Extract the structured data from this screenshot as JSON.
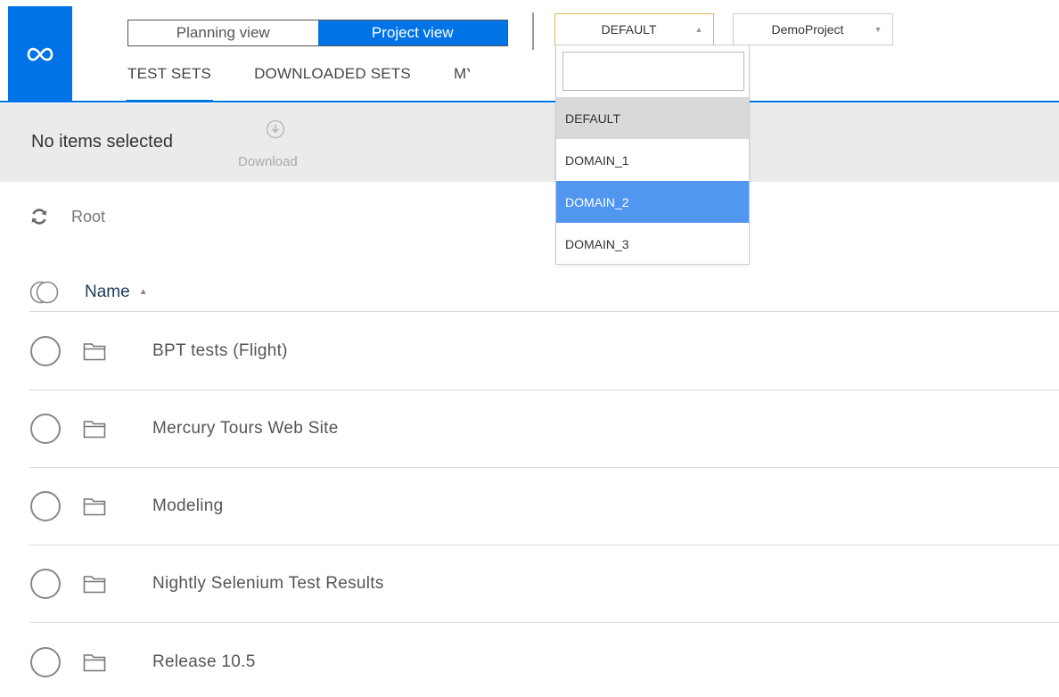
{
  "header": {
    "logo_icon": "infinity-logo-icon",
    "view_toggle": {
      "planning_label": "Planning view",
      "project_label": "Project view",
      "active": "Project view"
    },
    "domain_select": {
      "value": "DEFAULT",
      "arrow_icon": "triangle-up-icon"
    },
    "project_select": {
      "value": "DemoProject",
      "arrow_icon": "triangle-down-icon"
    },
    "tabs": [
      {
        "label": "TEST SETS",
        "active": true
      },
      {
        "label": "DOWNLOADED SETS",
        "active": false
      },
      {
        "label": "MY",
        "active": false
      }
    ],
    "accent_color": "#0073e7"
  },
  "toolbar": {
    "selection_text": "No items selected",
    "download_label": "Download",
    "download_icon": "download-circle-icon"
  },
  "breadcrumb": {
    "refresh_icon": "refresh-icon",
    "root_label": "Root"
  },
  "list": {
    "column_name": "Name",
    "sort_icon": "sort-icon",
    "rows": [
      {
        "label": "BPT tests (Flight)"
      },
      {
        "label": "Mercury Tours Web Site"
      },
      {
        "label": "Modeling"
      },
      {
        "label": "Nightly Selenium Test Results"
      },
      {
        "label": "Release 10.5"
      }
    ]
  },
  "domain_dropdown": {
    "search_placeholder": "",
    "options": [
      {
        "label": "DEFAULT",
        "state": "current"
      },
      {
        "label": "DOMAIN_1",
        "state": "normal"
      },
      {
        "label": "DOMAIN_2",
        "state": "hover"
      },
      {
        "label": "DOMAIN_3",
        "state": "normal"
      }
    ],
    "hover_color": "#5197f0"
  }
}
